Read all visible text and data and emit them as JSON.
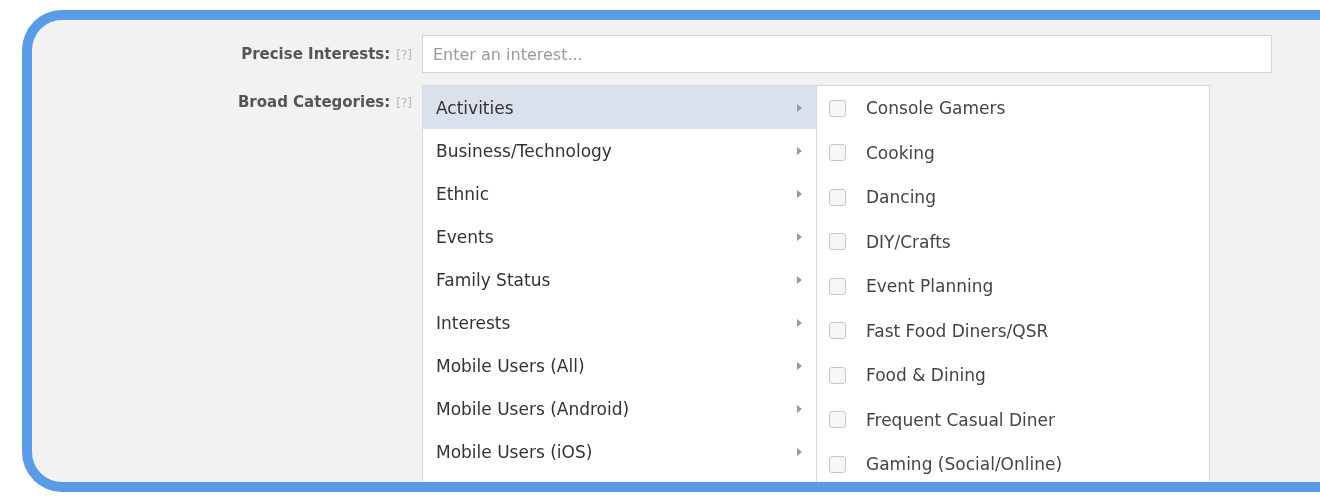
{
  "precise_interests": {
    "label": "Precise Interests:",
    "help": "[?]",
    "placeholder": "Enter an interest..."
  },
  "broad_categories": {
    "label": "Broad Categories:",
    "help": "[?]",
    "categories": [
      {
        "label": "Activities",
        "selected": true
      },
      {
        "label": "Business/Technology",
        "selected": false
      },
      {
        "label": "Ethnic",
        "selected": false
      },
      {
        "label": "Events",
        "selected": false
      },
      {
        "label": "Family Status",
        "selected": false
      },
      {
        "label": "Interests",
        "selected": false
      },
      {
        "label": "Mobile Users (All)",
        "selected": false
      },
      {
        "label": "Mobile Users (Android)",
        "selected": false
      },
      {
        "label": "Mobile Users (iOS)",
        "selected": false
      }
    ],
    "subcategories": [
      {
        "label": "Console Gamers",
        "checked": false
      },
      {
        "label": "Cooking",
        "checked": false
      },
      {
        "label": "Dancing",
        "checked": false
      },
      {
        "label": "DIY/Crafts",
        "checked": false
      },
      {
        "label": "Event Planning",
        "checked": false
      },
      {
        "label": "Fast Food Diners/QSR",
        "checked": false
      },
      {
        "label": "Food & Dining",
        "checked": false
      },
      {
        "label": "Frequent Casual Diner",
        "checked": false
      },
      {
        "label": "Gaming (Social/Online)",
        "checked": false
      }
    ]
  }
}
